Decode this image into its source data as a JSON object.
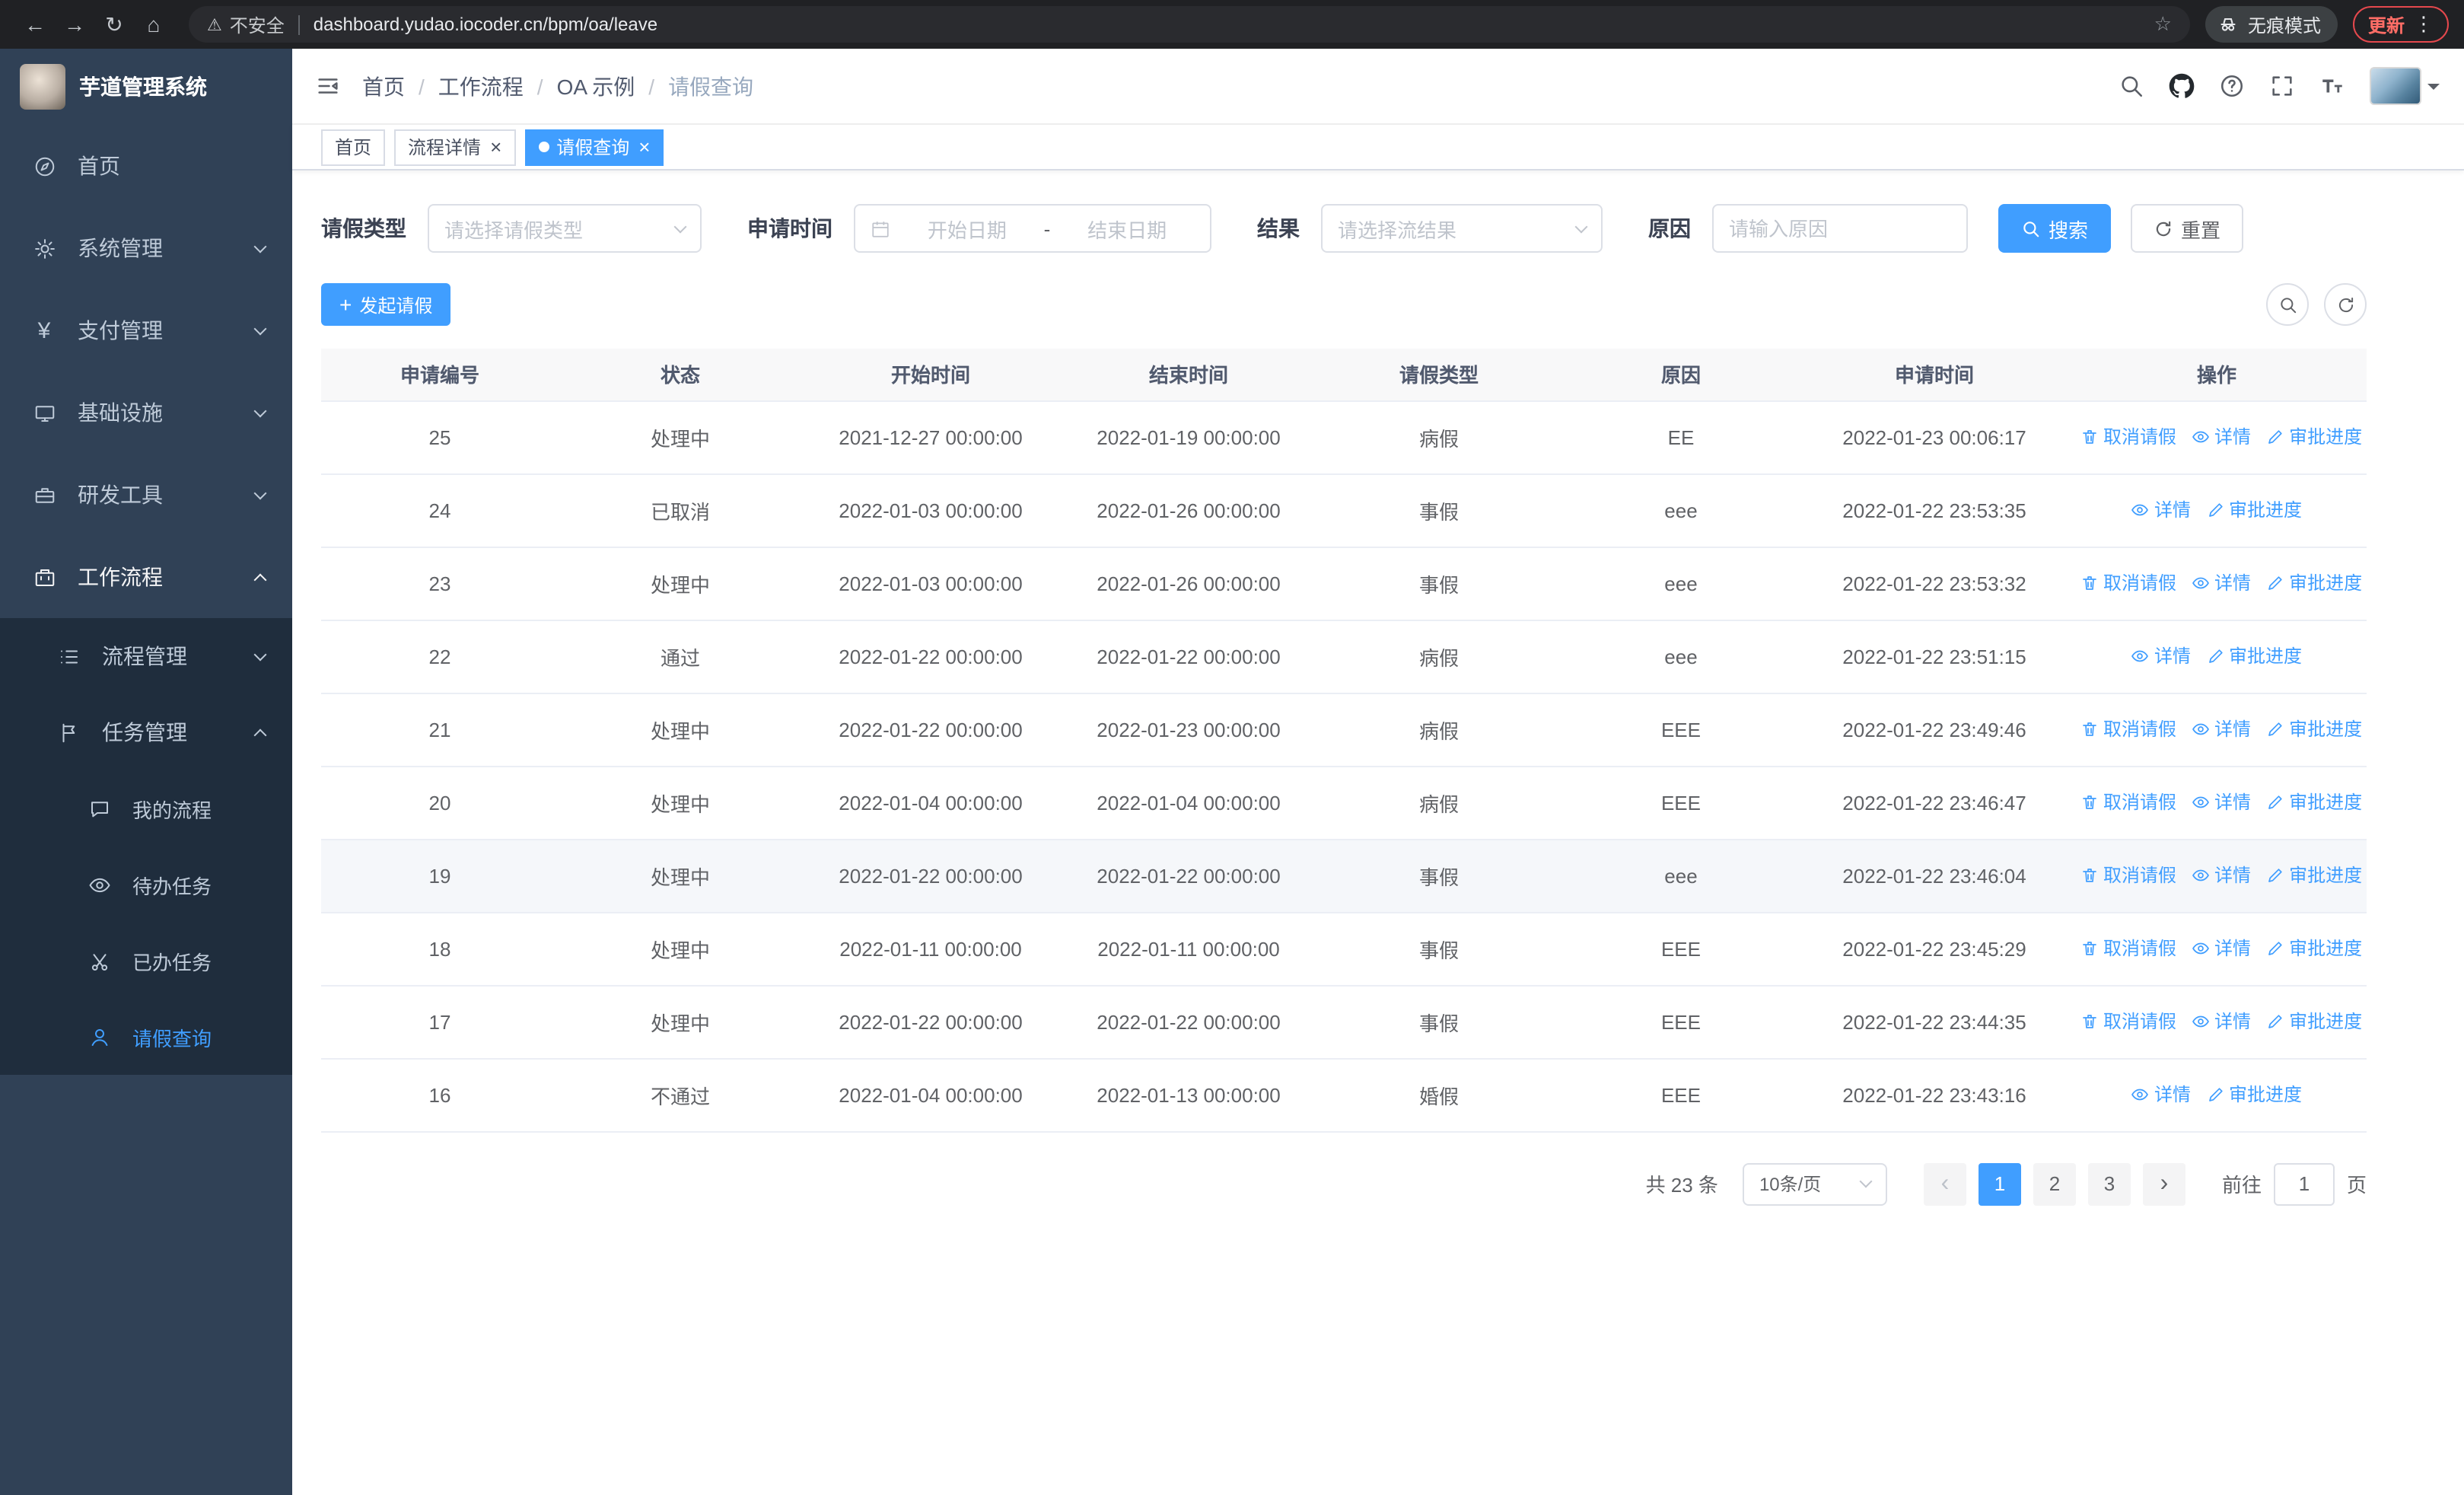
{
  "colors": {
    "primary": "#409EFF",
    "sidebar_bg": "#304156",
    "table_header_bg": "#F8F8F9"
  },
  "browser": {
    "security_label": "不安全",
    "url": "dashboard.yudao.iocoder.cn/bpm/oa/leave",
    "incognito_label": "无痕模式",
    "update_label": "更新"
  },
  "app_title": "芋道管理系统",
  "sidebar": {
    "items": [
      {
        "label": "首页"
      },
      {
        "label": "系统管理"
      },
      {
        "label": "支付管理"
      },
      {
        "label": "基础设施"
      },
      {
        "label": "研发工具"
      },
      {
        "label": "工作流程"
      }
    ],
    "sub_items": [
      {
        "label": "流程管理"
      },
      {
        "label": "任务管理"
      }
    ],
    "leaf_items": [
      {
        "label": "我的流程"
      },
      {
        "label": "待办任务"
      },
      {
        "label": "已办任务"
      },
      {
        "label": "请假查询"
      }
    ]
  },
  "breadcrumb": [
    "首页",
    "工作流程",
    "OA 示例",
    "请假查询"
  ],
  "breadcrumb_separator": "/",
  "tabs": [
    {
      "label": "首页"
    },
    {
      "label": "流程详情"
    },
    {
      "label": "请假查询"
    }
  ],
  "filters": {
    "leave_type_label": "请假类型",
    "leave_type_placeholder": "请选择请假类型",
    "apply_time_label": "申请时间",
    "start_date_placeholder": "开始日期",
    "range_separator": "-",
    "end_date_placeholder": "结束日期",
    "result_label": "结果",
    "result_placeholder": "请选择流结果",
    "reason_label": "原因",
    "reason_placeholder": "请输入原因",
    "search_label": "搜索",
    "reset_label": "重置"
  },
  "toolbar": {
    "create_label": "发起请假"
  },
  "table": {
    "columns": [
      "申请编号",
      "状态",
      "开始时间",
      "结束时间",
      "请假类型",
      "原因",
      "申请时间",
      "操作"
    ],
    "action_labels": {
      "cancel": "取消请假",
      "detail": "详情",
      "progress": "审批进度"
    },
    "rows": [
      {
        "id": "25",
        "status": "处理中",
        "start": "2021-12-27 00:00:00",
        "end": "2022-01-19 00:00:00",
        "type": "病假",
        "reason": "EE",
        "applied": "2022-01-23 00:06:17",
        "actions": [
          "cancel",
          "detail",
          "progress"
        ]
      },
      {
        "id": "24",
        "status": "已取消",
        "start": "2022-01-03 00:00:00",
        "end": "2022-01-26 00:00:00",
        "type": "事假",
        "reason": "eee",
        "applied": "2022-01-22 23:53:35",
        "actions": [
          "detail",
          "progress"
        ]
      },
      {
        "id": "23",
        "status": "处理中",
        "start": "2022-01-03 00:00:00",
        "end": "2022-01-26 00:00:00",
        "type": "事假",
        "reason": "eee",
        "applied": "2022-01-22 23:53:32",
        "actions": [
          "cancel",
          "detail",
          "progress"
        ]
      },
      {
        "id": "22",
        "status": "通过",
        "start": "2022-01-22 00:00:00",
        "end": "2022-01-22 00:00:00",
        "type": "病假",
        "reason": "eee",
        "applied": "2022-01-22 23:51:15",
        "actions": [
          "detail",
          "progress"
        ]
      },
      {
        "id": "21",
        "status": "处理中",
        "start": "2022-01-22 00:00:00",
        "end": "2022-01-23 00:00:00",
        "type": "病假",
        "reason": "EEE",
        "applied": "2022-01-22 23:49:46",
        "actions": [
          "cancel",
          "detail",
          "progress"
        ]
      },
      {
        "id": "20",
        "status": "处理中",
        "start": "2022-01-04 00:00:00",
        "end": "2022-01-04 00:00:00",
        "type": "病假",
        "reason": "EEE",
        "applied": "2022-01-22 23:46:47",
        "actions": [
          "cancel",
          "detail",
          "progress"
        ]
      },
      {
        "id": "19",
        "status": "处理中",
        "start": "2022-01-22 00:00:00",
        "end": "2022-01-22 00:00:00",
        "type": "事假",
        "reason": "eee",
        "applied": "2022-01-22 23:46:04",
        "actions": [
          "cancel",
          "detail",
          "progress"
        ],
        "highlighted": true
      },
      {
        "id": "18",
        "status": "处理中",
        "start": "2022-01-11 00:00:00",
        "end": "2022-01-11 00:00:00",
        "type": "事假",
        "reason": "EEE",
        "applied": "2022-01-22 23:45:29",
        "actions": [
          "cancel",
          "detail",
          "progress"
        ]
      },
      {
        "id": "17",
        "status": "处理中",
        "start": "2022-01-22 00:00:00",
        "end": "2022-01-22 00:00:00",
        "type": "事假",
        "reason": "EEE",
        "applied": "2022-01-22 23:44:35",
        "actions": [
          "cancel",
          "detail",
          "progress"
        ]
      },
      {
        "id": "16",
        "status": "不通过",
        "start": "2022-01-04 00:00:00",
        "end": "2022-01-13 00:00:00",
        "type": "婚假",
        "reason": "EEE",
        "applied": "2022-01-22 23:43:16",
        "actions": [
          "detail",
          "progress"
        ]
      }
    ]
  },
  "pagination": {
    "total_label": "共 23 条",
    "page_size": "10条/页",
    "pages": [
      "1",
      "2",
      "3"
    ],
    "active_page": "1",
    "goto_label": "前往",
    "goto_value": "1",
    "page_suffix_label": "页"
  },
  "icons": {
    "back": "←",
    "forward": "→",
    "reload": "↻",
    "home": "⌂",
    "warning": "⚠",
    "star": "☆",
    "menu_dots": "⋮",
    "close": "×",
    "plus": "+",
    "payment": "¥",
    "prev": "‹",
    "next": "›"
  }
}
